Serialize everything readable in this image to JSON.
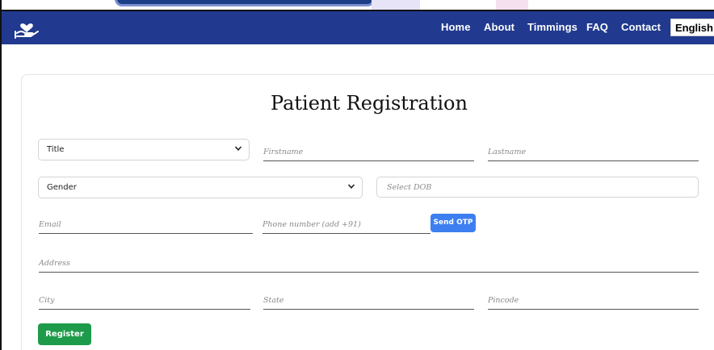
{
  "nav": {
    "home": "Home",
    "about": "About",
    "timmings": "Timmings",
    "faq": "FAQ",
    "contact": "Contact",
    "language": "English"
  },
  "form": {
    "title": "Patient Registration",
    "title_select": "Title",
    "firstname": "Firstname",
    "lastname": "Lastname",
    "gender_select": "Gender",
    "dob": "Select DOB",
    "email": "Email",
    "phone": "Phone number (add +91)",
    "send_otp": "Send OTP",
    "address": "Address",
    "city": "City",
    "state": "State",
    "pincode": "Pincode",
    "register": "Register"
  },
  "colors": {
    "navbar": "#213a8f",
    "otp_button": "#3d7ff0",
    "register_button": "#1e9b4a"
  },
  "icons": {
    "logo": "heart-hand-icon",
    "dropdown": "chevron-down-icon"
  }
}
